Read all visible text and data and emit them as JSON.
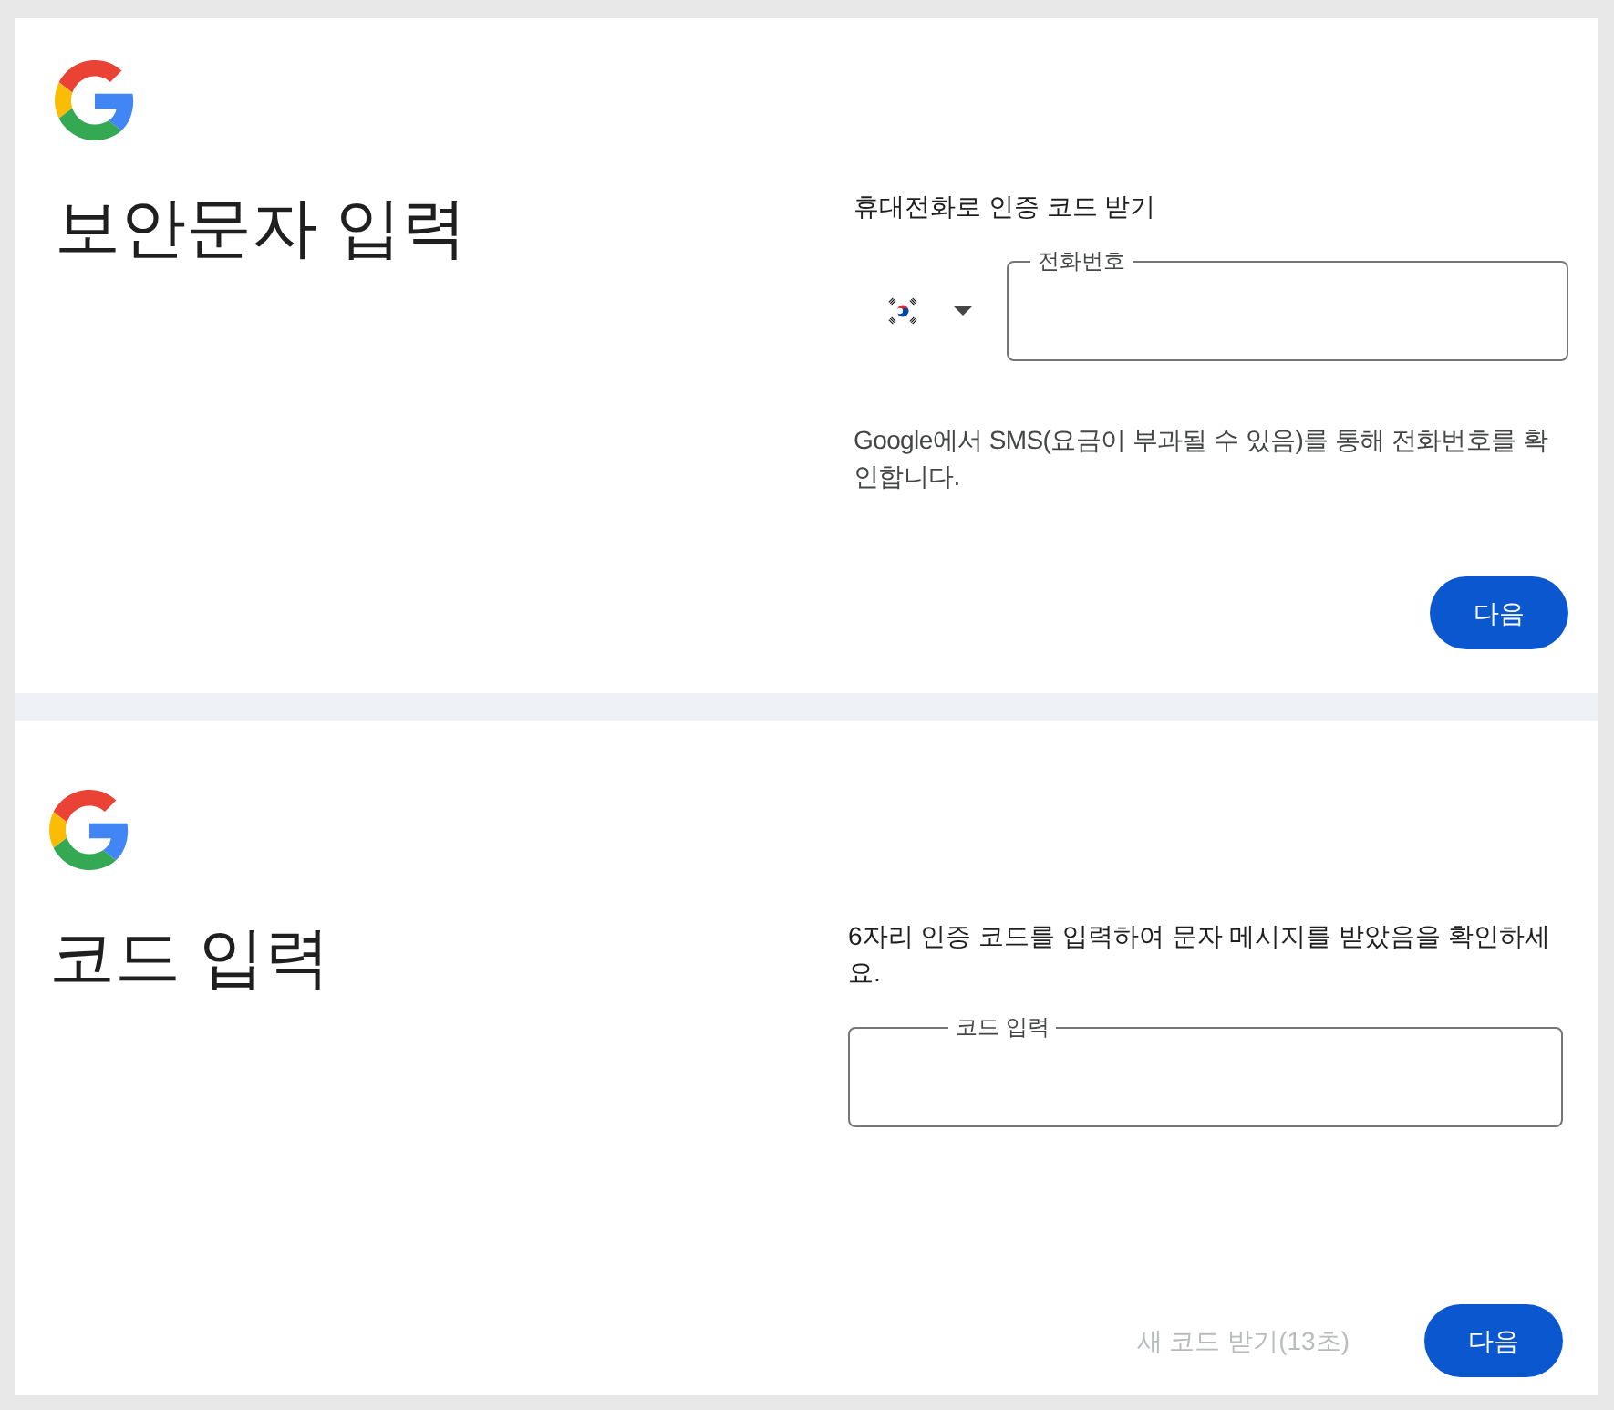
{
  "steps": [
    {
      "kind": "phone",
      "title": "보안문자 입력",
      "prompt": "휴대전화로 인증 코드 받기",
      "field": {
        "label": "전화번호"
      },
      "note": "Google에서 SMS(요금이 부과될 수 있음)를 통해 전화번호를 확인합니다.",
      "actions": [
        {
          "kind": "primary",
          "label": "다음",
          "disabled": false
        }
      ]
    },
    {
      "kind": "code",
      "title": "코드 입력",
      "prompt": "6자리 인증 코드를 입력하여 문자 메시지를 받았음을 확인하세요.",
      "field": {
        "label": "코드 입력"
      },
      "actions": [
        {
          "kind": "text",
          "label": "새 코드 받기(13초)",
          "disabled": true
        },
        {
          "kind": "primary",
          "label": "다음",
          "disabled": false
        }
      ]
    }
  ]
}
